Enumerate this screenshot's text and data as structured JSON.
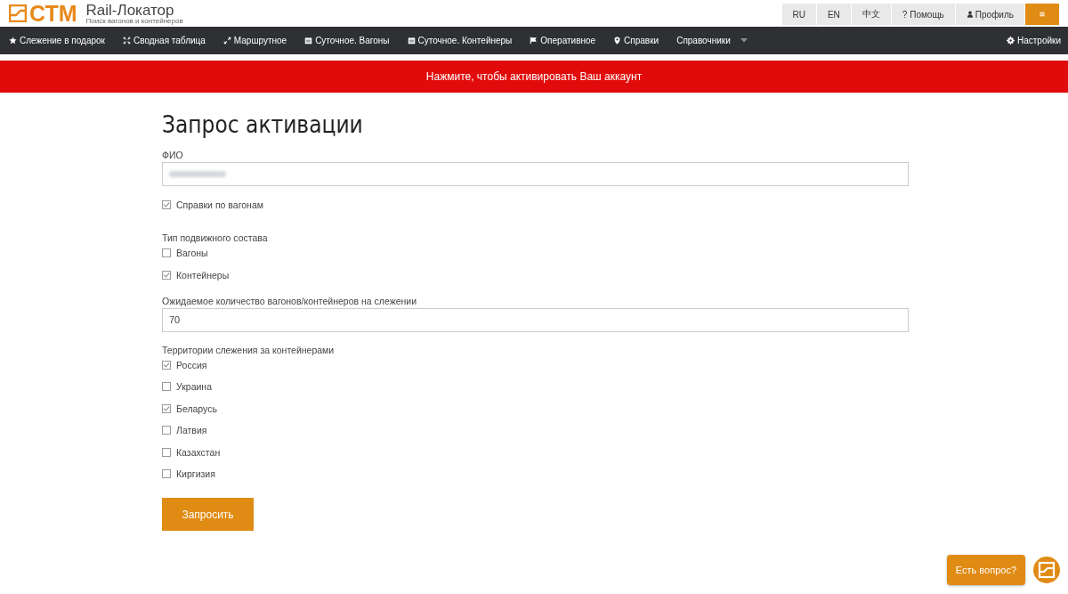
{
  "header": {
    "logo": "СТМ",
    "title": "Rail-Локатор",
    "subtitle": "Поиск вагонов и контейнеров",
    "top_buttons": [
      {
        "kind": "text",
        "label": "RU"
      },
      {
        "kind": "text",
        "label": "EN"
      },
      {
        "kind": "text",
        "label": "中文"
      },
      {
        "kind": "text",
        "label": "? Помощь"
      },
      {
        "kind": "profile",
        "label": "Профиль"
      },
      {
        "kind": "menu"
      }
    ]
  },
  "nav": {
    "items": [
      {
        "label": "Слежение в подарок"
      },
      {
        "label": "Сводная таблица"
      },
      {
        "label": "Маршрутное"
      },
      {
        "label": "Суточное. Вагоны"
      },
      {
        "label": "Суточное. Контейнеры"
      },
      {
        "label": "Оперативное"
      },
      {
        "label": "Справки"
      },
      {
        "label": "Справочники",
        "dropdown": true
      }
    ],
    "right": {
      "label": "Настройки"
    }
  },
  "banner": "Нажмите, чтобы активировать Ваш аккаунт",
  "form": {
    "title": "Запрос активации",
    "sections": [
      {
        "kind": "text",
        "label": "ФИО",
        "redacted": true
      },
      {
        "kind": "checkbox",
        "label": "Справки по вагонам",
        "checked": true
      },
      {
        "kind": "group",
        "label": "Тип подвижного состава",
        "options": [
          {
            "label": "Вагоны",
            "checked": false
          },
          {
            "label": "Контейнеры",
            "checked": true
          }
        ]
      },
      {
        "kind": "text",
        "label": "Ожидаемое количество вагонов/контейнеров на слежении",
        "value": "70"
      },
      {
        "kind": "group",
        "label": "Территории слежения за контейнерами",
        "options": [
          {
            "label": "Россия",
            "checked": true
          },
          {
            "label": "Украина",
            "checked": false
          },
          {
            "label": "Беларусь",
            "checked": true
          },
          {
            "label": "Латвия",
            "checked": false
          },
          {
            "label": "Казахстан",
            "checked": false
          },
          {
            "label": "Киргизия",
            "checked": false
          }
        ]
      }
    ],
    "submit": "Запросить"
  },
  "chat": {
    "label": "Есть вопрос?"
  }
}
